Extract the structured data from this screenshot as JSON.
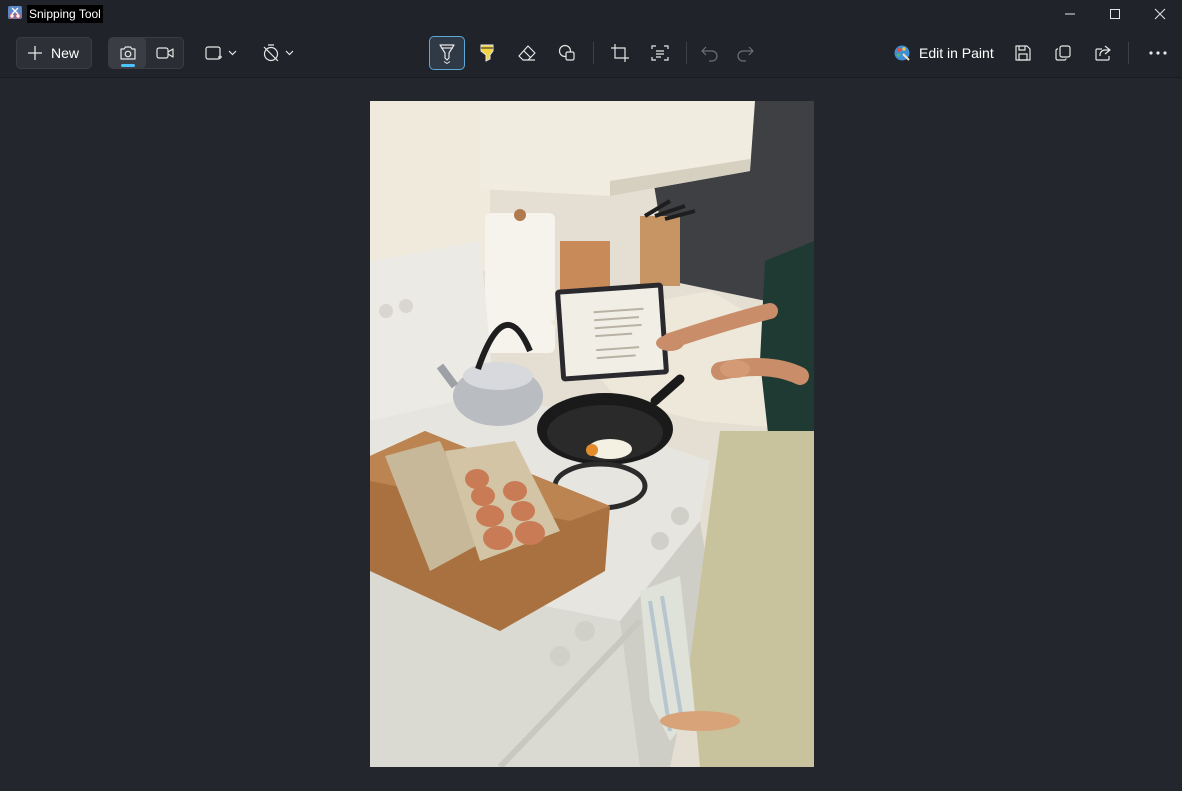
{
  "window": {
    "title": "Snipping Tool"
  },
  "toolbar": {
    "new_label": "New",
    "edit_in_paint_label": "Edit in Paint",
    "icons": [
      "camera-icon",
      "video-icon",
      "snip-shape-icon",
      "timer-icon",
      "ballpoint-pen-icon",
      "highlighter-icon",
      "eraser-icon",
      "shapes-icon",
      "crop-icon",
      "text-actions-icon",
      "undo-icon",
      "redo-icon",
      "paint-icon",
      "save-icon",
      "copy-icon",
      "share-icon",
      "more-icon"
    ]
  },
  "colors": {
    "accent": "#4cc2ff",
    "highlighter": "#f5d442",
    "background": "#202329"
  }
}
